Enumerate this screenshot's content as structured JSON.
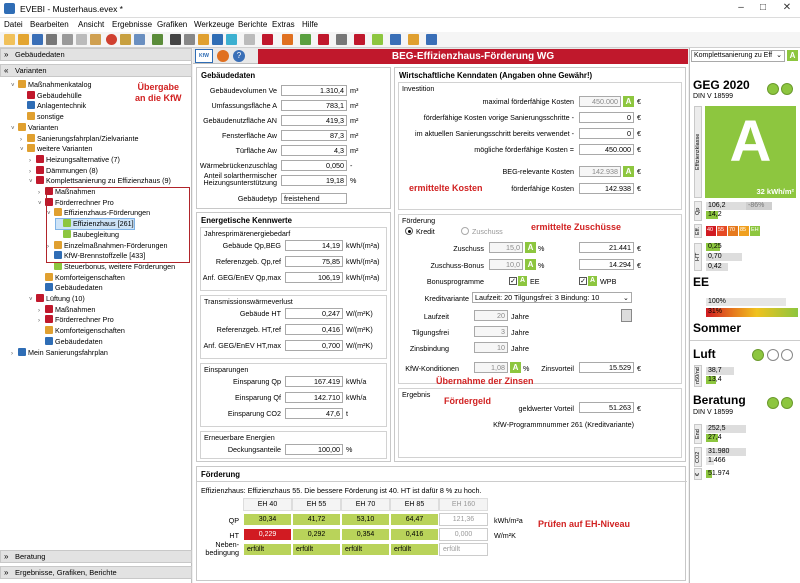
{
  "window": {
    "title": "EVEBI - Musterhaus.evex *"
  },
  "menu": [
    "Datei",
    "Bearbeiten",
    "Ansicht",
    "Ergebnisse",
    "Grafiken",
    "Werkzeuge",
    "Berichte",
    "Extras",
    "Hilfe"
  ],
  "left": {
    "gebaeudedaten_header": "Gebäudedaten",
    "varianten_header": "Varianten",
    "tree": [
      {
        "label": "Maßnahmenkatalog",
        "lvl": 1,
        "col": "#e0a030",
        "tg": "v"
      },
      {
        "label": "Gebäudehülle",
        "lvl": 2,
        "col": "#c0182c",
        "tg": ""
      },
      {
        "label": "Anlagentechnik",
        "lvl": 2,
        "col": "#2f6db5",
        "tg": ""
      },
      {
        "label": "sonstige",
        "lvl": 2,
        "col": "#e0a030",
        "tg": ""
      },
      {
        "label": "Varianten",
        "lvl": 1,
        "col": "#e0a030",
        "tg": "v"
      },
      {
        "label": "Sanierungsfahrplan/Zielvariante",
        "lvl": 2,
        "col": "#e0a030",
        "tg": ">"
      },
      {
        "label": "weitere Varianten",
        "lvl": 2,
        "col": "#e0a030",
        "tg": "v"
      },
      {
        "label": "Heizungsalternative (7)",
        "lvl": 3,
        "col": "#c0182c",
        "tg": ">"
      },
      {
        "label": "Dämmungen (8)",
        "lvl": 3,
        "col": "#c0182c",
        "tg": ">"
      },
      {
        "label": "Komplettsanierung zu Effizienzhaus (9)",
        "lvl": 3,
        "col": "#c0182c",
        "tg": "v"
      },
      {
        "label": "Maßnahmen",
        "lvl": 4,
        "col": "#c0182c",
        "tg": ">"
      },
      {
        "label": "Förderrechner Pro",
        "lvl": 4,
        "col": "#c0182c",
        "tg": "v"
      },
      {
        "label": "Effizienzhaus-Förderungen",
        "lvl": 5,
        "col": "#e0a030",
        "tg": "v"
      },
      {
        "label": "Effizienzhaus [261]",
        "lvl": 6,
        "col": "#8dc63f",
        "tg": "",
        "sel": true
      },
      {
        "label": "Baubegleitung",
        "lvl": 6,
        "col": "#8dc63f",
        "tg": ""
      },
      {
        "label": "Einzelmaßnahmen-Förderungen",
        "lvl": 5,
        "col": "#e0a030",
        "tg": ">"
      },
      {
        "label": "KfW-Brennstoffzelle [433]",
        "lvl": 5,
        "col": "#2f6db5",
        "tg": ""
      },
      {
        "label": "Steuerbonus, weitere Förderungen",
        "lvl": 5,
        "col": "#8dc63f",
        "tg": ""
      },
      {
        "label": "Komforteigenschaften",
        "lvl": 4,
        "col": "#e0a030",
        "tg": ""
      },
      {
        "label": "Gebäudedaten",
        "lvl": 4,
        "col": "#2f6db5",
        "tg": ""
      },
      {
        "label": "Lüftung (10)",
        "lvl": 3,
        "col": "#c0182c",
        "tg": "v"
      },
      {
        "label": "Maßnahmen",
        "lvl": 4,
        "col": "#c0182c",
        "tg": ">"
      },
      {
        "label": "Förderrechner Pro",
        "lvl": 4,
        "col": "#c0182c",
        "tg": ">"
      },
      {
        "label": "Komforteigenschaften",
        "lvl": 4,
        "col": "#e0a030",
        "tg": ""
      },
      {
        "label": "Gebäudedaten",
        "lvl": 4,
        "col": "#2f6db5",
        "tg": ""
      },
      {
        "label": "Mein Sanierungsfahrplan",
        "lvl": 1,
        "col": "#2f6db5",
        "tg": ">"
      }
    ],
    "beratung_header": "Beratung",
    "ergebnisse_header": "Ergebnisse, Grafiken, Berichte",
    "annotation": "Übergabe\nan die KfW"
  },
  "center": {
    "title": "BEG-Effizienzhaus-Förderung WG",
    "kfw_btn": "KfW",
    "gebaeudedaten": {
      "header": "Gebäudedaten",
      "rows": [
        {
          "label": "Gebäudevolumen Ve",
          "value": "1.310,4",
          "unit": "m³"
        },
        {
          "label": "Umfassungsfläche A",
          "value": "783,1",
          "unit": "m²"
        },
        {
          "label": "Gebäudenutzfläche AN",
          "value": "419,3",
          "unit": "m²"
        },
        {
          "label": "Fensterfläche Aw",
          "value": "87,3",
          "unit": "m²"
        },
        {
          "label": "Türfläche Aw",
          "value": "4,3",
          "unit": "m²"
        },
        {
          "label": "Wärmebrückenzuschlag",
          "value": "0,050",
          "unit": "-"
        },
        {
          "label": "Anteil solarthermischer Heizungsunterstützung",
          "value": "19,18",
          "unit": "%"
        },
        {
          "label": "Gebäudetyp",
          "value": "freistehend",
          "unit": ""
        }
      ]
    },
    "energetische": {
      "header": "Energetische Kennwerte",
      "g1": {
        "label": "Jahresprimärenergiebedarf",
        "rows": [
          {
            "label": "Gebäude Qp,BEG",
            "value": "14,19",
            "unit": "kWh/(m²a)"
          },
          {
            "label": "Referenzgeb. Qp,ref",
            "value": "75,85",
            "unit": "kWh/(m²a)"
          },
          {
            "label": "Anf. GEG/EnEV Qp,max",
            "value": "106,19",
            "unit": "kWh/(m²a)"
          }
        ]
      },
      "g2": {
        "label": "Transmissionswärmeverlust",
        "rows": [
          {
            "label": "Gebäude HT",
            "value": "0,247",
            "unit": "W/(m²K)"
          },
          {
            "label": "Referenzgeb. HT,ref",
            "value": "0,416",
            "unit": "W/(m²K)"
          },
          {
            "label": "Anf. GEG/EnEV HT,max",
            "value": "0,700",
            "unit": "W/(m²K)"
          }
        ]
      },
      "g3": {
        "label": "Einsparungen",
        "rows": [
          {
            "label": "Einsparung Qp",
            "value": "167.419",
            "unit": "kWh/a"
          },
          {
            "label": "Einsparung Qf",
            "value": "142.710",
            "unit": "kWh/a"
          },
          {
            "label": "Einsparung CO2",
            "value": "47,6",
            "unit": "t"
          }
        ]
      },
      "g4": {
        "label": "Erneuerbare Energien",
        "rows": [
          {
            "label": "Deckungsanteile",
            "value": "100,00",
            "unit": "%"
          }
        ]
      }
    },
    "wirtschaft": {
      "header": "Wirtschaftliche Kenndaten (Angaben ohne Gewähr!)",
      "investition": {
        "label": "Investition",
        "rows": [
          {
            "label": "maximal förderfähige Kosten",
            "value": "450.000",
            "gray": true,
            "a": true,
            "unit": "€"
          },
          {
            "label": "förderfähige Kosten vorige Sanierungsschritte -",
            "value": "0",
            "gray": false,
            "a": false,
            "unit": "€"
          },
          {
            "label": "im aktuellen Sanierungsschritt bereits verwendet -",
            "value": "0",
            "gray": false,
            "a": false,
            "unit": "€"
          },
          {
            "label": "mögliche förderfähige Kosten =",
            "value": "450.000",
            "gray": false,
            "a": false,
            "unit": "€"
          },
          {
            "label": "BEG-relevante Kosten",
            "value": "142.938",
            "gray": true,
            "a": true,
            "unit": "€"
          },
          {
            "label": "förderfähige Kosten",
            "value": "142.938",
            "gray": false,
            "a": false,
            "unit": "€"
          }
        ]
      },
      "foerderung": {
        "label": "Förderung",
        "kredit": "Kredit",
        "zuschuss": "Zuschuss",
        "zuschuss_pct": "15,0",
        "zuschuss_val": "21.441",
        "bonus_pct": "10,0",
        "bonus_val": "14.294",
        "zuschuss_lbl": "Zuschuss",
        "bonus_lbl": "Zuschuss-Bonus",
        "bonusprog_lbl": "Bonusprogramme",
        "ee": "EE",
        "wpb": "WPB",
        "kreditvariante_lbl": "Kreditvariante",
        "kreditvariante": "Laufzeit: 20 Tilgungsfrei: 3 Bindung: 10",
        "laufzeit_lbl": "Laufzeit",
        "laufzeit": "20",
        "tilg_lbl": "Tilgungsfrei",
        "tilg": "3",
        "zins_lbl": "Zinsbindung",
        "zins": "10",
        "jahre": "Jahre",
        "kfwk_lbl": "KfW-Konditionen",
        "kfwk": "1,08",
        "zinsvorteil_lbl": "Zinsvorteil",
        "zinsvorteil": "15.529",
        "pct": "%",
        "eur": "€"
      },
      "ergebnis": {
        "label": "Ergebnis",
        "geldwert_lbl": "geldwerter Vorteil",
        "geldwert": "51.263",
        "programm": "KfW-Programmnummer 261 (Kreditvariante)"
      }
    },
    "foerderung_tab": {
      "header": "Förderung",
      "note": "Effizienzhaus: Effizienzhaus 55. Die bessere Förderung ist 40. HT ist dafür 8 % zu hoch.",
      "cols": [
        "EH 40",
        "EH 55",
        "EH 70",
        "EH 85",
        "EH 160"
      ],
      "qp_lbl": "QP",
      "ht_lbl": "HT",
      "neben_lbl": "Neben-\nbedingung",
      "unit_qp": "kWh/m²a",
      "unit_ht": "W/m²K",
      "qp": [
        "30,34",
        "41,72",
        "53,10",
        "64,47",
        "121,36"
      ],
      "ht": [
        "0,229",
        "0,292",
        "0,354",
        "0,416",
        "0,000"
      ],
      "nb": [
        "erfüllt",
        "erfüllt",
        "erfüllt",
        "erfüllt",
        "erfüllt"
      ]
    },
    "annotations": {
      "kosten": "ermittelte Kosten",
      "zuschuesse": "ermittelte Zuschüsse",
      "zinsen": "Übernahme der Zinsen",
      "foerdergeld": "Fördergeld",
      "pruefen": "Prüfen auf EH-Niveau"
    }
  },
  "right": {
    "dropdown": "Komplettsanierung zu Eff",
    "geg": {
      "title": "GEG 2020",
      "sub": "DIN V 18599",
      "klasse_lbl": "Effizienzklasse",
      "klasse": "A",
      "klasse_val": "32 kWh/m²",
      "qp_lbl": "Qp",
      "qp1": "106,2",
      "qp2": "14,2",
      "qp_pct": "-86%",
      "ek_lbl": "Eff.",
      "ek": [
        "40",
        "55",
        "70",
        "85",
        "EH"
      ],
      "ht_lbl": "H'T",
      "ht": [
        "0,25",
        "0,70",
        "0,42"
      ]
    },
    "ee": {
      "title": "EE",
      "v1": "100%",
      "v2": "31%"
    },
    "sommer": {
      "title": "Sommer"
    },
    "luft": {
      "title": "Luft",
      "lbl": "n50/nd",
      "v1": "38,7",
      "v2": "13,4"
    },
    "beratung": {
      "title": "Beratung",
      "sub": "DIN V 18599",
      "end_lbl": "End",
      "end1": "252,5",
      "end2": "27,4",
      "co2_lbl": "CO2",
      "co2_1": "31.980",
      "co2_2": "1.466",
      "eur_lbl": "€",
      "eur": "51.974"
    }
  },
  "colors": {
    "accent_red": "#c0182c",
    "green": "#8dc63f",
    "annotation": "#d12222"
  }
}
